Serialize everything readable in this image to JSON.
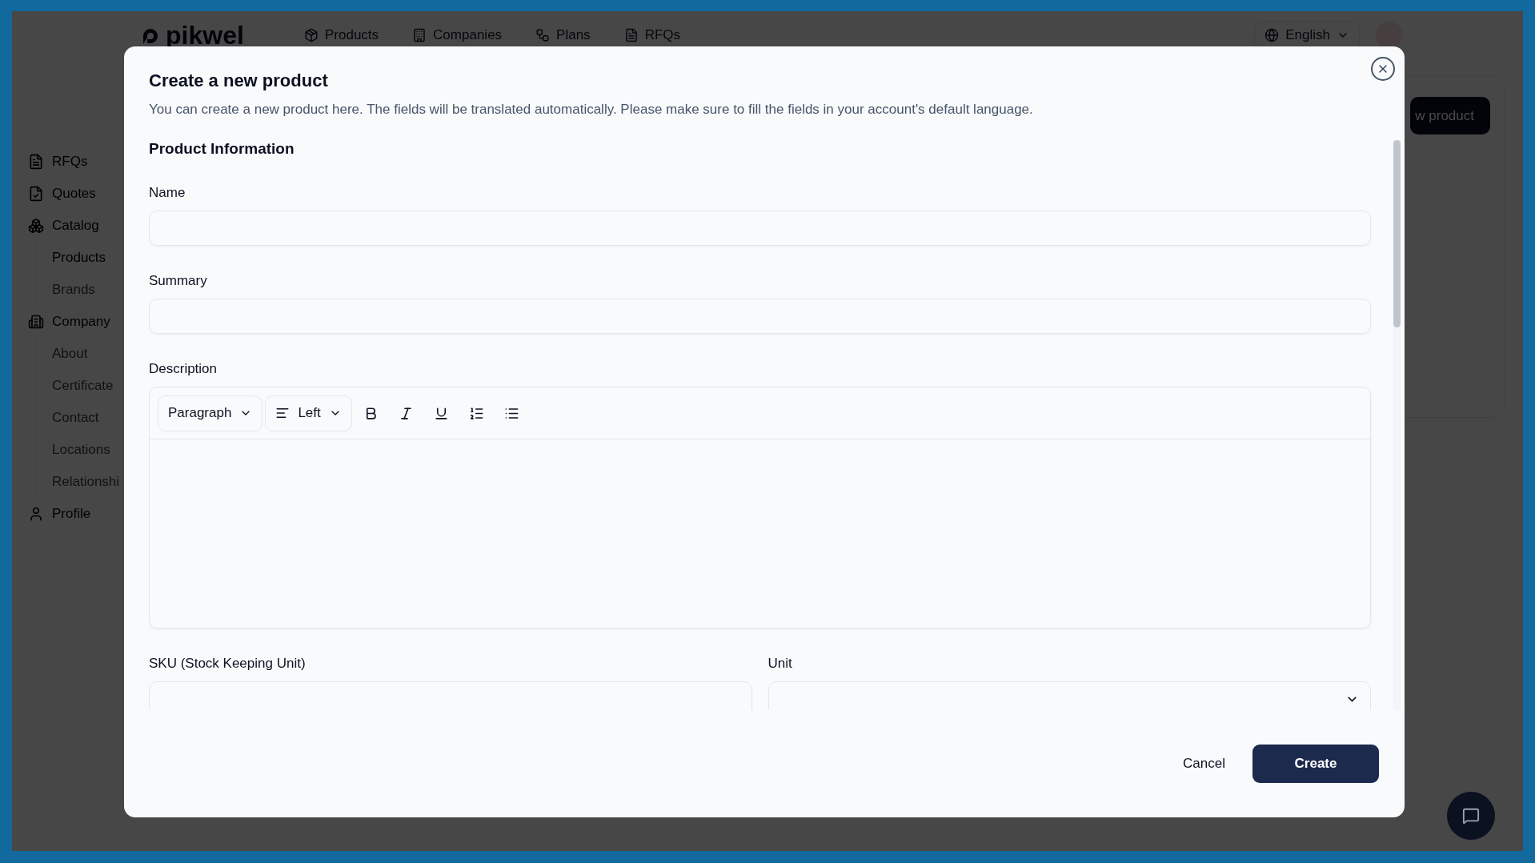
{
  "nav": {
    "logo": "pikwel",
    "links": [
      {
        "label": "Products"
      },
      {
        "label": "Companies"
      },
      {
        "label": "Plans"
      },
      {
        "label": "RFQs"
      }
    ],
    "language": "English"
  },
  "sidebar": {
    "items": [
      {
        "label": "RFQs"
      },
      {
        "label": "Quotes"
      },
      {
        "label": "Catalog",
        "children": [
          {
            "label": "Products",
            "selected": true
          },
          {
            "label": "Brands",
            "selected": false
          }
        ]
      },
      {
        "label": "Company",
        "children": [
          {
            "label": "About",
            "selected": false
          },
          {
            "label": "Certificate",
            "selected": false
          },
          {
            "label": "Contact",
            "selected": false
          },
          {
            "label": "Locations",
            "selected": false
          },
          {
            "label": "Relationshi",
            "selected": false
          }
        ]
      },
      {
        "label": "Profile"
      }
    ]
  },
  "page": {
    "new_button": "w product"
  },
  "modal": {
    "title": "Create a new product",
    "description": "You can create a new product here. The fields will be translated automatically. Please make sure to fill the fields in your account's default language.",
    "section": "Product Information",
    "fields": [
      {
        "label": "Name",
        "kind": "text"
      },
      {
        "label": "Summary",
        "kind": "text"
      },
      {
        "label": "Description",
        "kind": "editor",
        "toolbar": {
          "block_style": "Paragraph",
          "align": "Left"
        }
      }
    ],
    "row_fields": [
      {
        "label": "SKU (Stock Keeping Unit)",
        "kind": "text"
      },
      {
        "label": "Unit",
        "kind": "select"
      }
    ],
    "buttons": [
      {
        "label": "Cancel",
        "kind": "secondary"
      },
      {
        "label": "Create",
        "kind": "primary"
      }
    ]
  }
}
